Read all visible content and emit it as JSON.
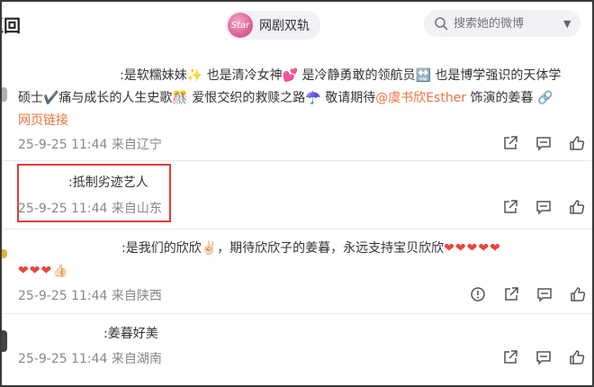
{
  "header": {
    "back_label": "返回",
    "back_visible": "返回",
    "channel_name": "网剧双轨",
    "avatar_text": "Star",
    "search_placeholder": "搜索她的微博"
  },
  "comments": [
    {
      "line1": ":是软糯妹妹✨ 也是清冷女神💕 是冷静勇敢的领航员🔛 也是博学强识的天体学",
      "line2_a": "硕士✔️痛与成长的人生史歌🎊 爱恨交织的救赎之路☂️ 敬请期待",
      "mention": "@虞书欣Esther",
      "line2_b": " 饰演的姜暮",
      "link": "网页链接",
      "time": "25-9-25 11:44",
      "source": "来自辽宁"
    },
    {
      "text": ":抵制劣迹艺人",
      "time": "25-9-25 11:44",
      "source": "来自山东"
    },
    {
      "line1": ":是我们的欣欣✌🏻，期待欣欣子的姜暮，永远支持宝贝欣欣",
      "line1_hearts": "❤❤❤❤❤",
      "line2_hearts": "❤❤❤",
      "thumb": "👍🏻",
      "time": "25-9-25 11:44",
      "source": "来自陕西"
    },
    {
      "text": ":姜暮好美",
      "time": "25-9-25 11:44",
      "source": "来自湖南"
    }
  ],
  "colors": {
    "accent": "#eb7340",
    "highlight_box": "#e03c3c",
    "heart": "#e8453c"
  },
  "icons": [
    "search-icon",
    "chevron-down-icon",
    "share-icon",
    "comment-icon",
    "like-icon",
    "report-icon"
  ]
}
